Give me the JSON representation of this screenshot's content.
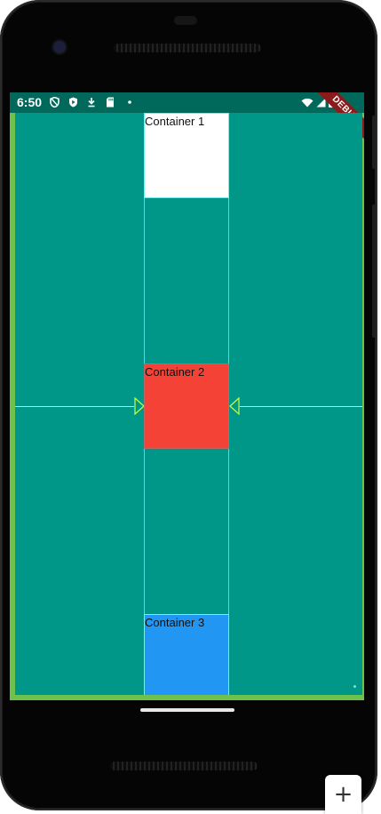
{
  "status_bar": {
    "time": "6:50",
    "icons": [
      "shield-icon",
      "play-protect-icon",
      "download-icon",
      "sd-card-icon",
      "dot-icon",
      "wifi-icon",
      "signal-icon",
      "battery-icon"
    ]
  },
  "debug_banner": "DEBUG",
  "containers": [
    {
      "label": "Container 1",
      "color": "#ffffff"
    },
    {
      "label": "Container 2",
      "color": "#f44336"
    },
    {
      "label": "Container 3",
      "color": "#2196f3"
    }
  ],
  "colors": {
    "app_background": "#009688",
    "status_bar": "#00695c",
    "screen_border": "#6cc24a",
    "guide_line": "#46e0e0",
    "baseline_line": "#c8ff3a"
  },
  "fab": {
    "icon": "plus-icon",
    "glyph": "+"
  }
}
